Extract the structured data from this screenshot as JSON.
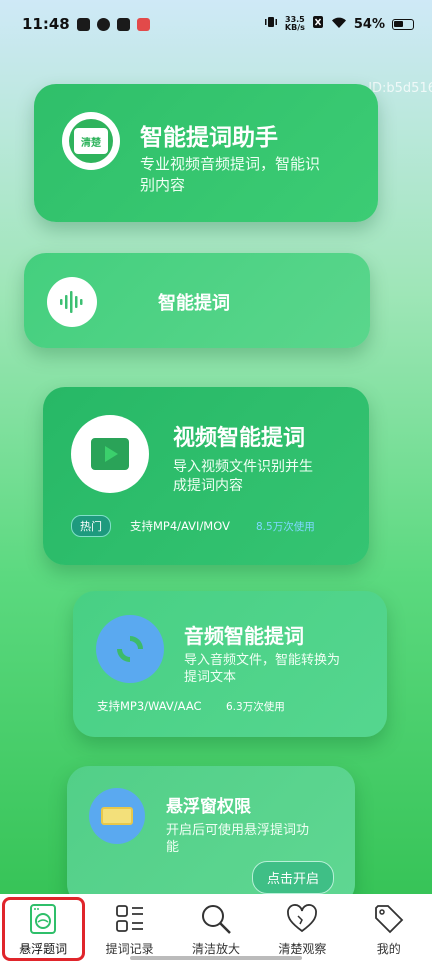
{
  "status_bar": {
    "time": "11:48",
    "speed_value": "33.5",
    "speed_unit": "KB/s",
    "battery": "54%"
  },
  "watermark": "ID:b5d516",
  "cards": {
    "assistant": {
      "icon_text": "清楚",
      "title": "智能提词助手",
      "subtitle_line1": "专业视频音频提词，智能识",
      "subtitle_line2": "别内容"
    },
    "smart": {
      "title": "智能提词"
    },
    "video": {
      "title": "视频智能提词",
      "subtitle_line1": "导入视频文件识别并生",
      "subtitle_line2": "成提词内容",
      "tag": "热门",
      "formats": "支持MP4/AVI/MOV",
      "usage": "8.5万次使用"
    },
    "audio": {
      "title": "音频智能提词",
      "subtitle_line1": "导入音频文件，智能转换为",
      "subtitle_line2": "提词文本",
      "formats": "支持MP3/WAV/AAC",
      "usage": "6.3万次使用"
    },
    "float": {
      "title": "悬浮窗权限",
      "subtitle_line1": "开启后可使用悬浮提词功",
      "subtitle_line2": "能",
      "button": "点击开启"
    }
  },
  "tabs": [
    {
      "label": "悬浮题词",
      "icon": "washing-machine-icon",
      "active": true
    },
    {
      "label": "提词记录",
      "icon": "list-icon"
    },
    {
      "label": "清洁放大",
      "icon": "magnifier-icon"
    },
    {
      "label": "清楚观察",
      "icon": "hearts-icon"
    },
    {
      "label": "我的",
      "icon": "tag-icon"
    }
  ],
  "colors": {
    "accent": "#2fbf6a",
    "active_frame": "#e0252b"
  }
}
